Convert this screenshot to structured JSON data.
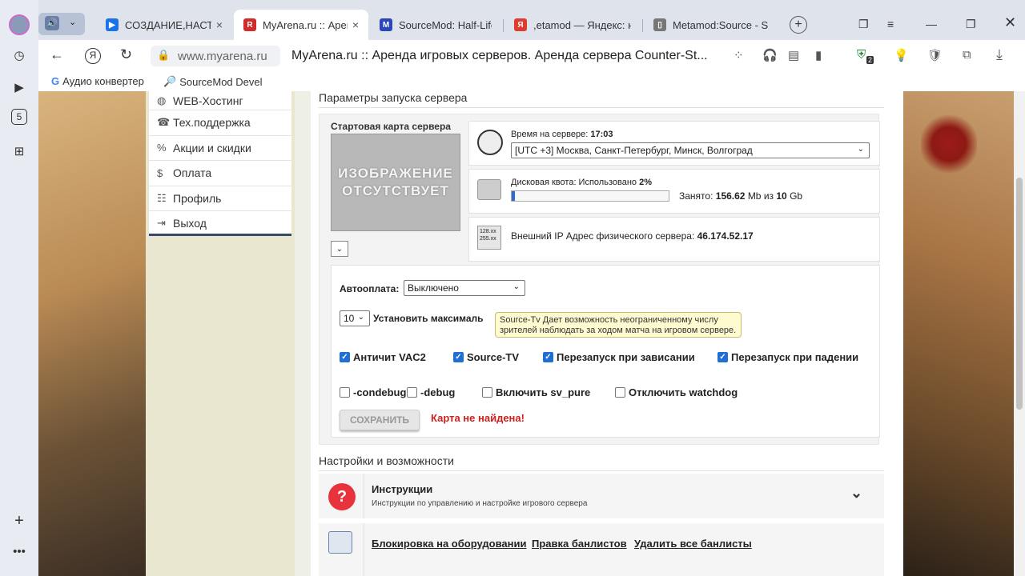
{
  "browser": {
    "tabs": [
      {
        "title": "СОЗДАНИЕ,НАСТ",
        "fav": "▶",
        "fav_color": "#1a73e8",
        "audio": "🔊"
      },
      {
        "title": "MyArena.ru :: Арен",
        "fav": "R",
        "fav_color": "#d22b2b"
      },
      {
        "title": "SourceMod: Half-Life",
        "fav": "M",
        "fav_color": "#2b46b8"
      },
      {
        "title": ",etamod — Яндекс: н",
        "fav": "Я",
        "fav_color": "#e03b2d"
      },
      {
        "title": "Metamod:Source - Sn",
        "fav": "▯",
        "fav_color": "#777"
      }
    ],
    "url": "www.myarena.ru",
    "page_title": "MyArena.ru :: Аренда игровых серверов. Аренда сервера Counter-St...",
    "bookmarks": [
      "Аудио конвертер",
      "SourceMod Devel"
    ],
    "sidebar_badge": "5",
    "ext_badge": "2"
  },
  "sidemenu": [
    {
      "label": "WEB-Хостинг",
      "icon": "globe-icon",
      "glyph": "◍"
    },
    {
      "label": "Тех.поддержка",
      "icon": "support-icon",
      "glyph": "☎"
    },
    {
      "label": "Акции и скидки",
      "icon": "percent-icon",
      "glyph": "%"
    },
    {
      "label": "Оплата",
      "icon": "dollar-icon",
      "glyph": "$"
    },
    {
      "label": "Профиль",
      "icon": "profile-icon",
      "glyph": "☷"
    },
    {
      "label": "Выход",
      "icon": "exit-icon",
      "glyph": "⇥"
    }
  ],
  "launch": {
    "section_title": "Параметры запуска сервера",
    "map_label": "Стартовая карта сервера",
    "map_placeholder_1": "ИЗОБРАЖЕНИЕ",
    "map_placeholder_2": "ОТСУТСТВУЕТ",
    "time_label": "Время на сервере:",
    "time_value": "17:03",
    "timezone": "[UTC +3] Москва, Санкт-Петербург, Минск, Волгоград",
    "disk_label": "Дисковая квота: Использовано",
    "disk_percent": "2%",
    "disk_fraction": 0.02,
    "used_label": "Занято:",
    "used_value": "156.62",
    "used_unit": "Mb из",
    "total_value": "10",
    "total_unit": "Gb",
    "ip_label": "Внешний IP Адрес физического сервера:",
    "ip_value": "46.174.52.17",
    "autopay_label": "Автооплата:",
    "autopay_value": "Выключено",
    "slots_value": "10",
    "slots_label": "Установить максималь",
    "tooltip": "Source-Tv Дает возможность неограниченному числу зрителей наблюдать за ходом матча на игровом сервере.",
    "checks_row1": [
      {
        "label": "Античит VAC2",
        "checked": true
      },
      {
        "label": "Source-TV",
        "checked": true
      },
      {
        "label": "Перезапуск при зависании",
        "checked": true
      },
      {
        "label": "Перезапуск при падении",
        "checked": true
      }
    ],
    "checks_row2": [
      {
        "label": "-condebug",
        "checked": false
      },
      {
        "label": "-debug",
        "checked": false
      },
      {
        "label": "Включить sv_pure",
        "checked": false
      },
      {
        "label": "Отключить watchdog",
        "checked": false
      }
    ],
    "save_label": "СОХРАНИТЬ",
    "error": "Карта не найдена!"
  },
  "settings": {
    "section_title": "Настройки и возможности",
    "instr_title": "Инструкции",
    "instr_sub": "Инструкции по управлению и настройке игрового сервера",
    "links": [
      "Блокировка на оборудовании",
      "Правка банлистов",
      "Удалить все банлисты"
    ]
  }
}
